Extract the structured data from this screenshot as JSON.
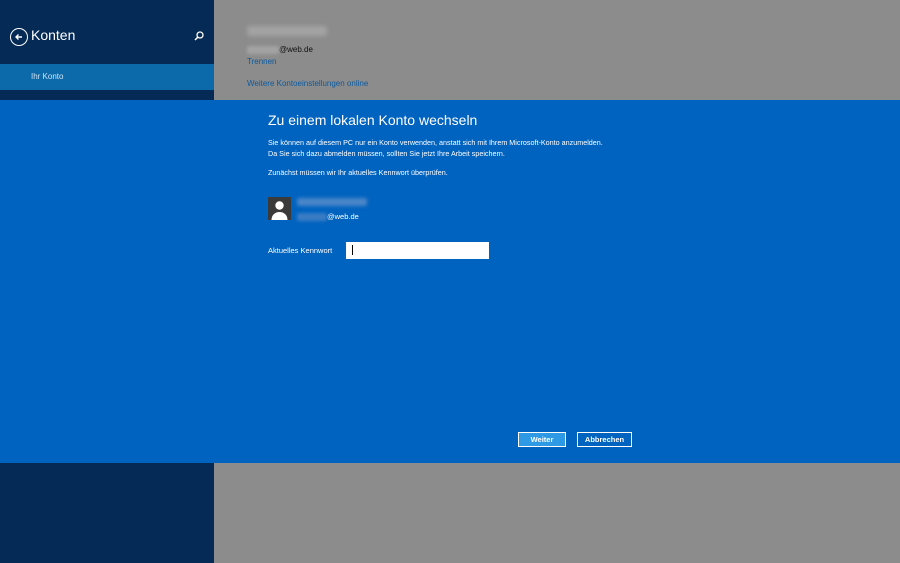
{
  "sidebar": {
    "title": "Konten",
    "back_icon": "back-arrow-icon",
    "search_icon": "search-icon",
    "items": [
      {
        "label": "Ihr Konto",
        "selected": true
      }
    ]
  },
  "content": {
    "account_email_suffix": "@web.de",
    "disconnect_link": "Trennen",
    "online_settings_link": "Weitere Kontoeinstellungen online"
  },
  "dialog": {
    "title": "Zu einem lokalen Konto wechseln",
    "description": "Sie können auf diesem PC nur ein Konto verwenden, anstatt sich mit Ihrem Microsoft-Konto anzumelden. Da Sie sich dazu abmelden müssen, sollten Sie jetzt Ihre Arbeit speichern.",
    "verify_text": "Zunächst müssen wir Ihr aktuelles Kennwort überprüfen.",
    "user_email_suffix": "@web.de",
    "password_label": "Aktuelles Kennwort",
    "password_value": "",
    "next_button": "Weiter",
    "cancel_button": "Abbrechen"
  },
  "colors": {
    "sidebar_bg": "#052a55",
    "sidebar_selected": "#0d6aaa",
    "dialog_bg": "#0063bf",
    "content_dim": "#8c8c8c",
    "primary_button": "#2e9ae6"
  }
}
